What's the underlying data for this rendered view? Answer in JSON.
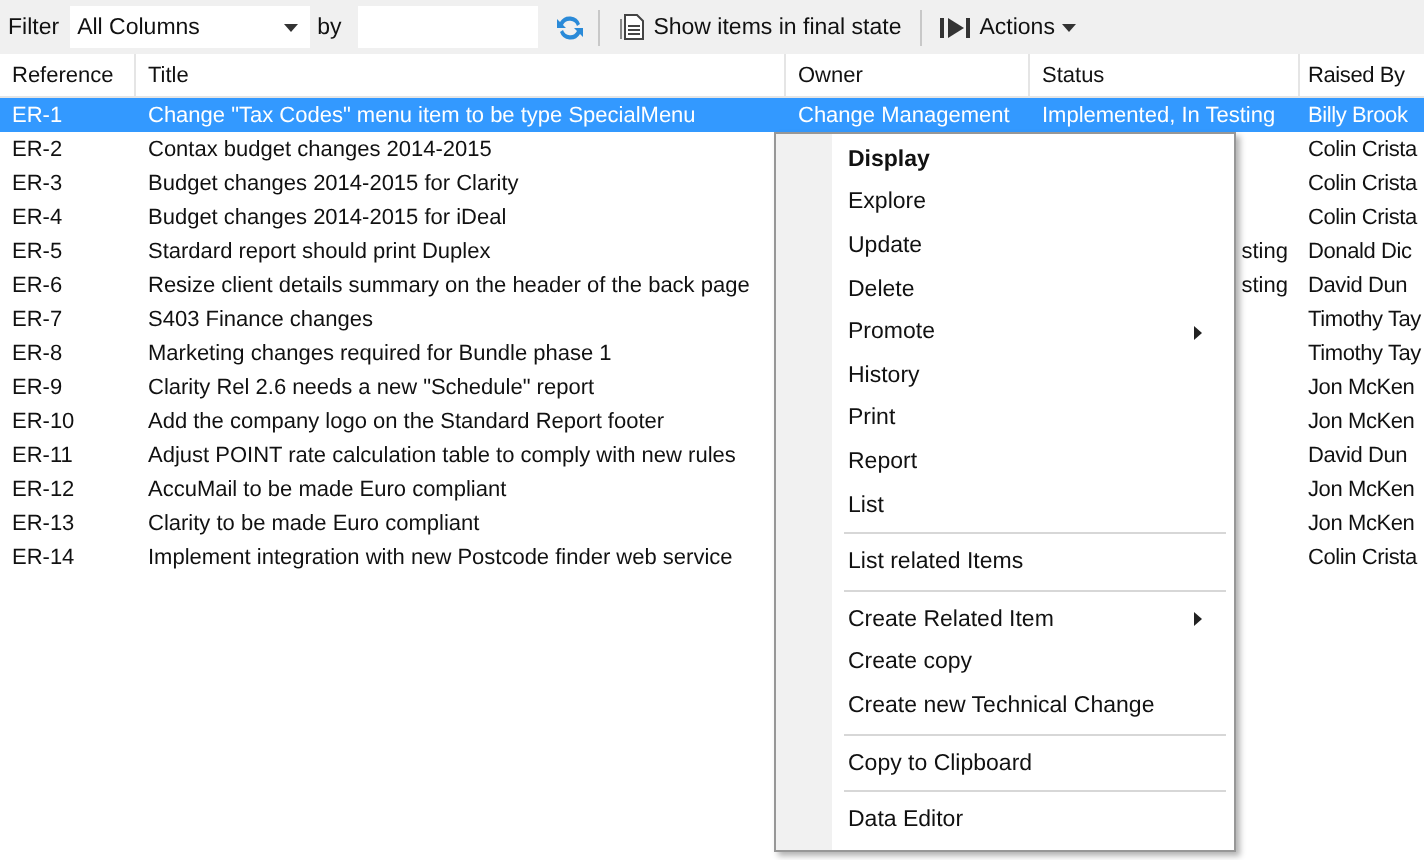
{
  "toolbar": {
    "filter_label": "Filter",
    "column_select": "All Columns",
    "by_label": "by",
    "show_final": "Show items in final state",
    "actions": "Actions"
  },
  "table": {
    "columns": [
      "Reference",
      "Title",
      "Owner",
      "Status",
      "Raised By"
    ],
    "rows": [
      {
        "ref": "ER-1",
        "title": "Change \"Tax Codes\" menu item to be type SpecialMenu",
        "owner": "Change Management",
        "status": "Implemented, In Testing",
        "raised_by": "Billy Brook",
        "selected": true
      },
      {
        "ref": "ER-2",
        "title": "Contax budget changes 2014-2015",
        "raised_by": "Colin Crista",
        "selected": false
      },
      {
        "ref": "ER-3",
        "title": "Budget changes 2014-2015 for Clarity",
        "raised_by": "Colin Crista",
        "selected": false
      },
      {
        "ref": "ER-4",
        "title": "Budget changes 2014-2015 for iDeal",
        "raised_by": "Colin Crista",
        "selected": false
      },
      {
        "ref": "ER-5",
        "title": "Stardard report should print Duplex",
        "status_tail": "sting",
        "raised_by": "Donald Dic",
        "selected": false
      },
      {
        "ref": "ER-6",
        "title": "Resize client details summary on the header of the back page",
        "status_tail": "sting",
        "raised_by": "David Dun",
        "selected": false
      },
      {
        "ref": "ER-7",
        "title": "S403 Finance changes",
        "raised_by": "Timothy Tay",
        "selected": false
      },
      {
        "ref": "ER-8",
        "title": "Marketing changes required for Bundle phase 1",
        "raised_by": "Timothy Tay",
        "selected": false
      },
      {
        "ref": "ER-9",
        "title": "Clarity Rel 2.6 needs a new \"Schedule\" report",
        "raised_by": "Jon McKen",
        "selected": false
      },
      {
        "ref": "ER-10",
        "title": "Add the company logo on the Standard Report footer",
        "raised_by": "Jon McKen",
        "selected": false
      },
      {
        "ref": "ER-11",
        "title": "Adjust POINT rate calculation table to comply with new rules",
        "raised_by": "David Dun",
        "selected": false
      },
      {
        "ref": "ER-12",
        "title": "AccuMail to be made Euro compliant",
        "raised_by": "Jon McKen",
        "selected": false
      },
      {
        "ref": "ER-13",
        "title": "Clarity to be made Euro compliant",
        "raised_by": "Jon McKen",
        "selected": false
      },
      {
        "ref": "ER-14",
        "title": "Implement integration with new Postcode finder web service",
        "raised_by": "Colin Crista",
        "selected": false
      }
    ]
  },
  "context_menu": [
    {
      "kind": "item",
      "label": "Display",
      "bold": true,
      "submenu": false
    },
    {
      "kind": "item",
      "label": "Explore",
      "bold": false,
      "submenu": false
    },
    {
      "kind": "item",
      "label": "Update",
      "bold": false,
      "submenu": false
    },
    {
      "kind": "item",
      "label": "Delete",
      "bold": false,
      "submenu": false
    },
    {
      "kind": "item",
      "label": "Promote",
      "bold": false,
      "submenu": true
    },
    {
      "kind": "item",
      "label": "History",
      "bold": false,
      "submenu": false
    },
    {
      "kind": "item",
      "label": "Print",
      "bold": false,
      "submenu": false
    },
    {
      "kind": "item",
      "label": "Report",
      "bold": false,
      "submenu": false
    },
    {
      "kind": "item",
      "label": "List",
      "bold": false,
      "submenu": false
    },
    {
      "kind": "separator"
    },
    {
      "kind": "item",
      "label": "List related Items",
      "bold": false,
      "submenu": false
    },
    {
      "kind": "separator"
    },
    {
      "kind": "item",
      "label": "Create Related Item",
      "bold": false,
      "submenu": true
    },
    {
      "kind": "item",
      "label": "Create copy",
      "bold": false,
      "submenu": false
    },
    {
      "kind": "item",
      "label": "Create new Technical Change",
      "bold": false,
      "submenu": false
    },
    {
      "kind": "separator"
    },
    {
      "kind": "item",
      "label": "Copy to Clipboard",
      "bold": false,
      "submenu": false
    },
    {
      "kind": "separator"
    },
    {
      "kind": "item",
      "label": "Data Editor",
      "bold": false,
      "submenu": false
    }
  ]
}
